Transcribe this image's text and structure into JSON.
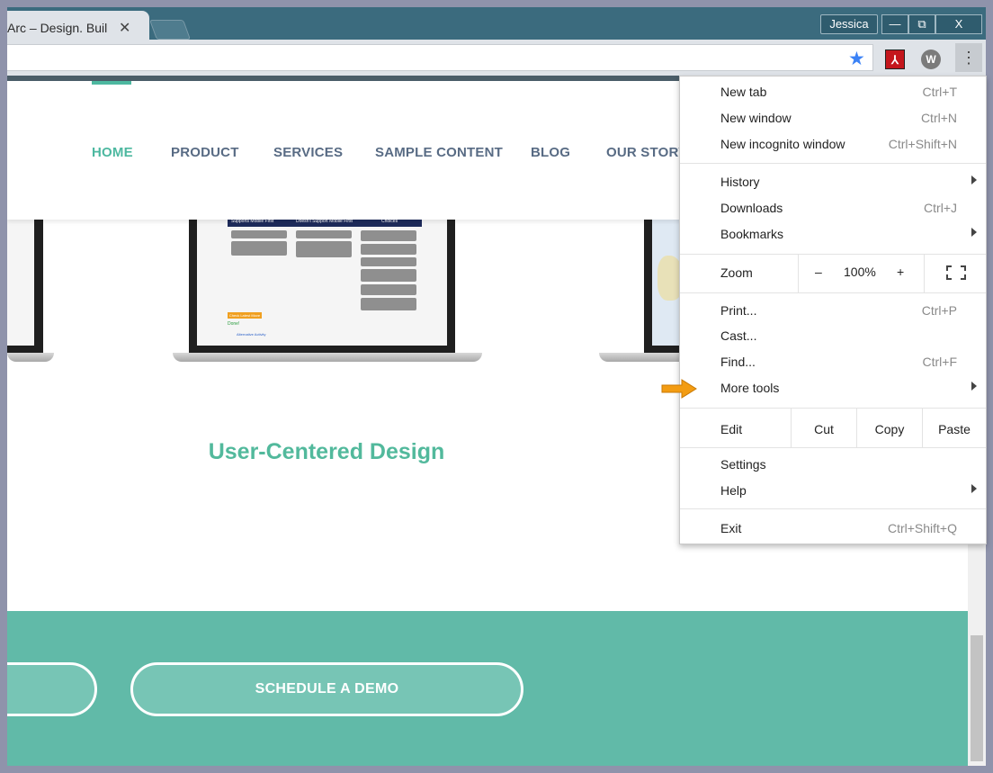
{
  "browser": {
    "tab_title": "Arc – Design. Buil",
    "tab_close": "✕",
    "profile_name": "Jessica",
    "minimize": "—",
    "restore": "⧉",
    "close": "X",
    "bookmark_star": "★",
    "pdf_ext": "⅄",
    "w_ext": "W",
    "menu_button": "⋮"
  },
  "page": {
    "nav": [
      "HOME",
      "PRODUCT",
      "SERVICES",
      "SAMPLE CONTENT",
      "BLOG",
      "OUR STORY"
    ],
    "heading": "User-Centered Design",
    "demo_button": "SCHEDULE A DEMO",
    "screen_headers": [
      "Supports Mobile First",
      "Doesn't Support Mobile First",
      "Choices"
    ],
    "screen_tag": "Check Latest Move",
    "screen_check": "Done!",
    "screen_link": "Alternative Activity"
  },
  "menu": {
    "items1": [
      {
        "label": "New tab",
        "shortcut": "Ctrl+T"
      },
      {
        "label": "New window",
        "shortcut": "Ctrl+N"
      },
      {
        "label": "New incognito window",
        "shortcut": "Ctrl+Shift+N"
      }
    ],
    "history": "History",
    "downloads": "Downloads",
    "downloads_shortcut": "Ctrl+J",
    "bookmarks": "Bookmarks",
    "zoom_label": "Zoom",
    "zoom_minus": "–",
    "zoom_value": "100%",
    "zoom_plus": "+",
    "print": "Print...",
    "print_shortcut": "Ctrl+P",
    "cast": "Cast...",
    "find": "Find...",
    "find_shortcut": "Ctrl+F",
    "more_tools": "More tools",
    "edit_label": "Edit",
    "cut": "Cut",
    "copy": "Copy",
    "paste": "Paste",
    "settings": "Settings",
    "help": "Help",
    "exit": "Exit",
    "exit_shortcut": "Ctrl+Shift+Q"
  },
  "colors": {
    "accent": "#4db8a0",
    "band": "#61baa8",
    "nav_text": "#586b84",
    "pointer_arrow": "#f39c12"
  }
}
